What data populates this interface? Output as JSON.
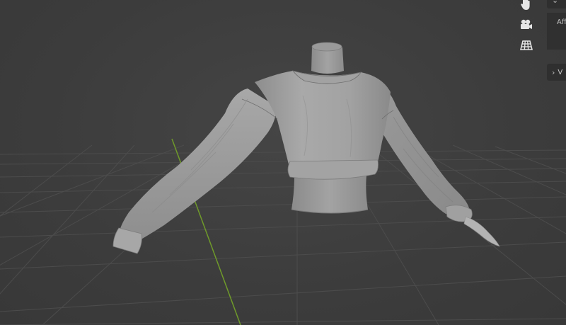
{
  "viewport": {
    "background_color": "#3d3d3d",
    "grid_color": "#4a4a4a",
    "y_axis_color": "#6f9a2a",
    "model_color": "#9e9e9e"
  },
  "navigation_gizmo": {
    "pan_icon": "hand-icon",
    "camera_icon": "camera-icon",
    "projection_icon": "grid-perspective-icon"
  },
  "sidebar": {
    "top_panel_body_text": "Aff",
    "bottom_panel_label": "V",
    "collapsed_chevron": "›",
    "expanded_chevron": "⌄"
  }
}
